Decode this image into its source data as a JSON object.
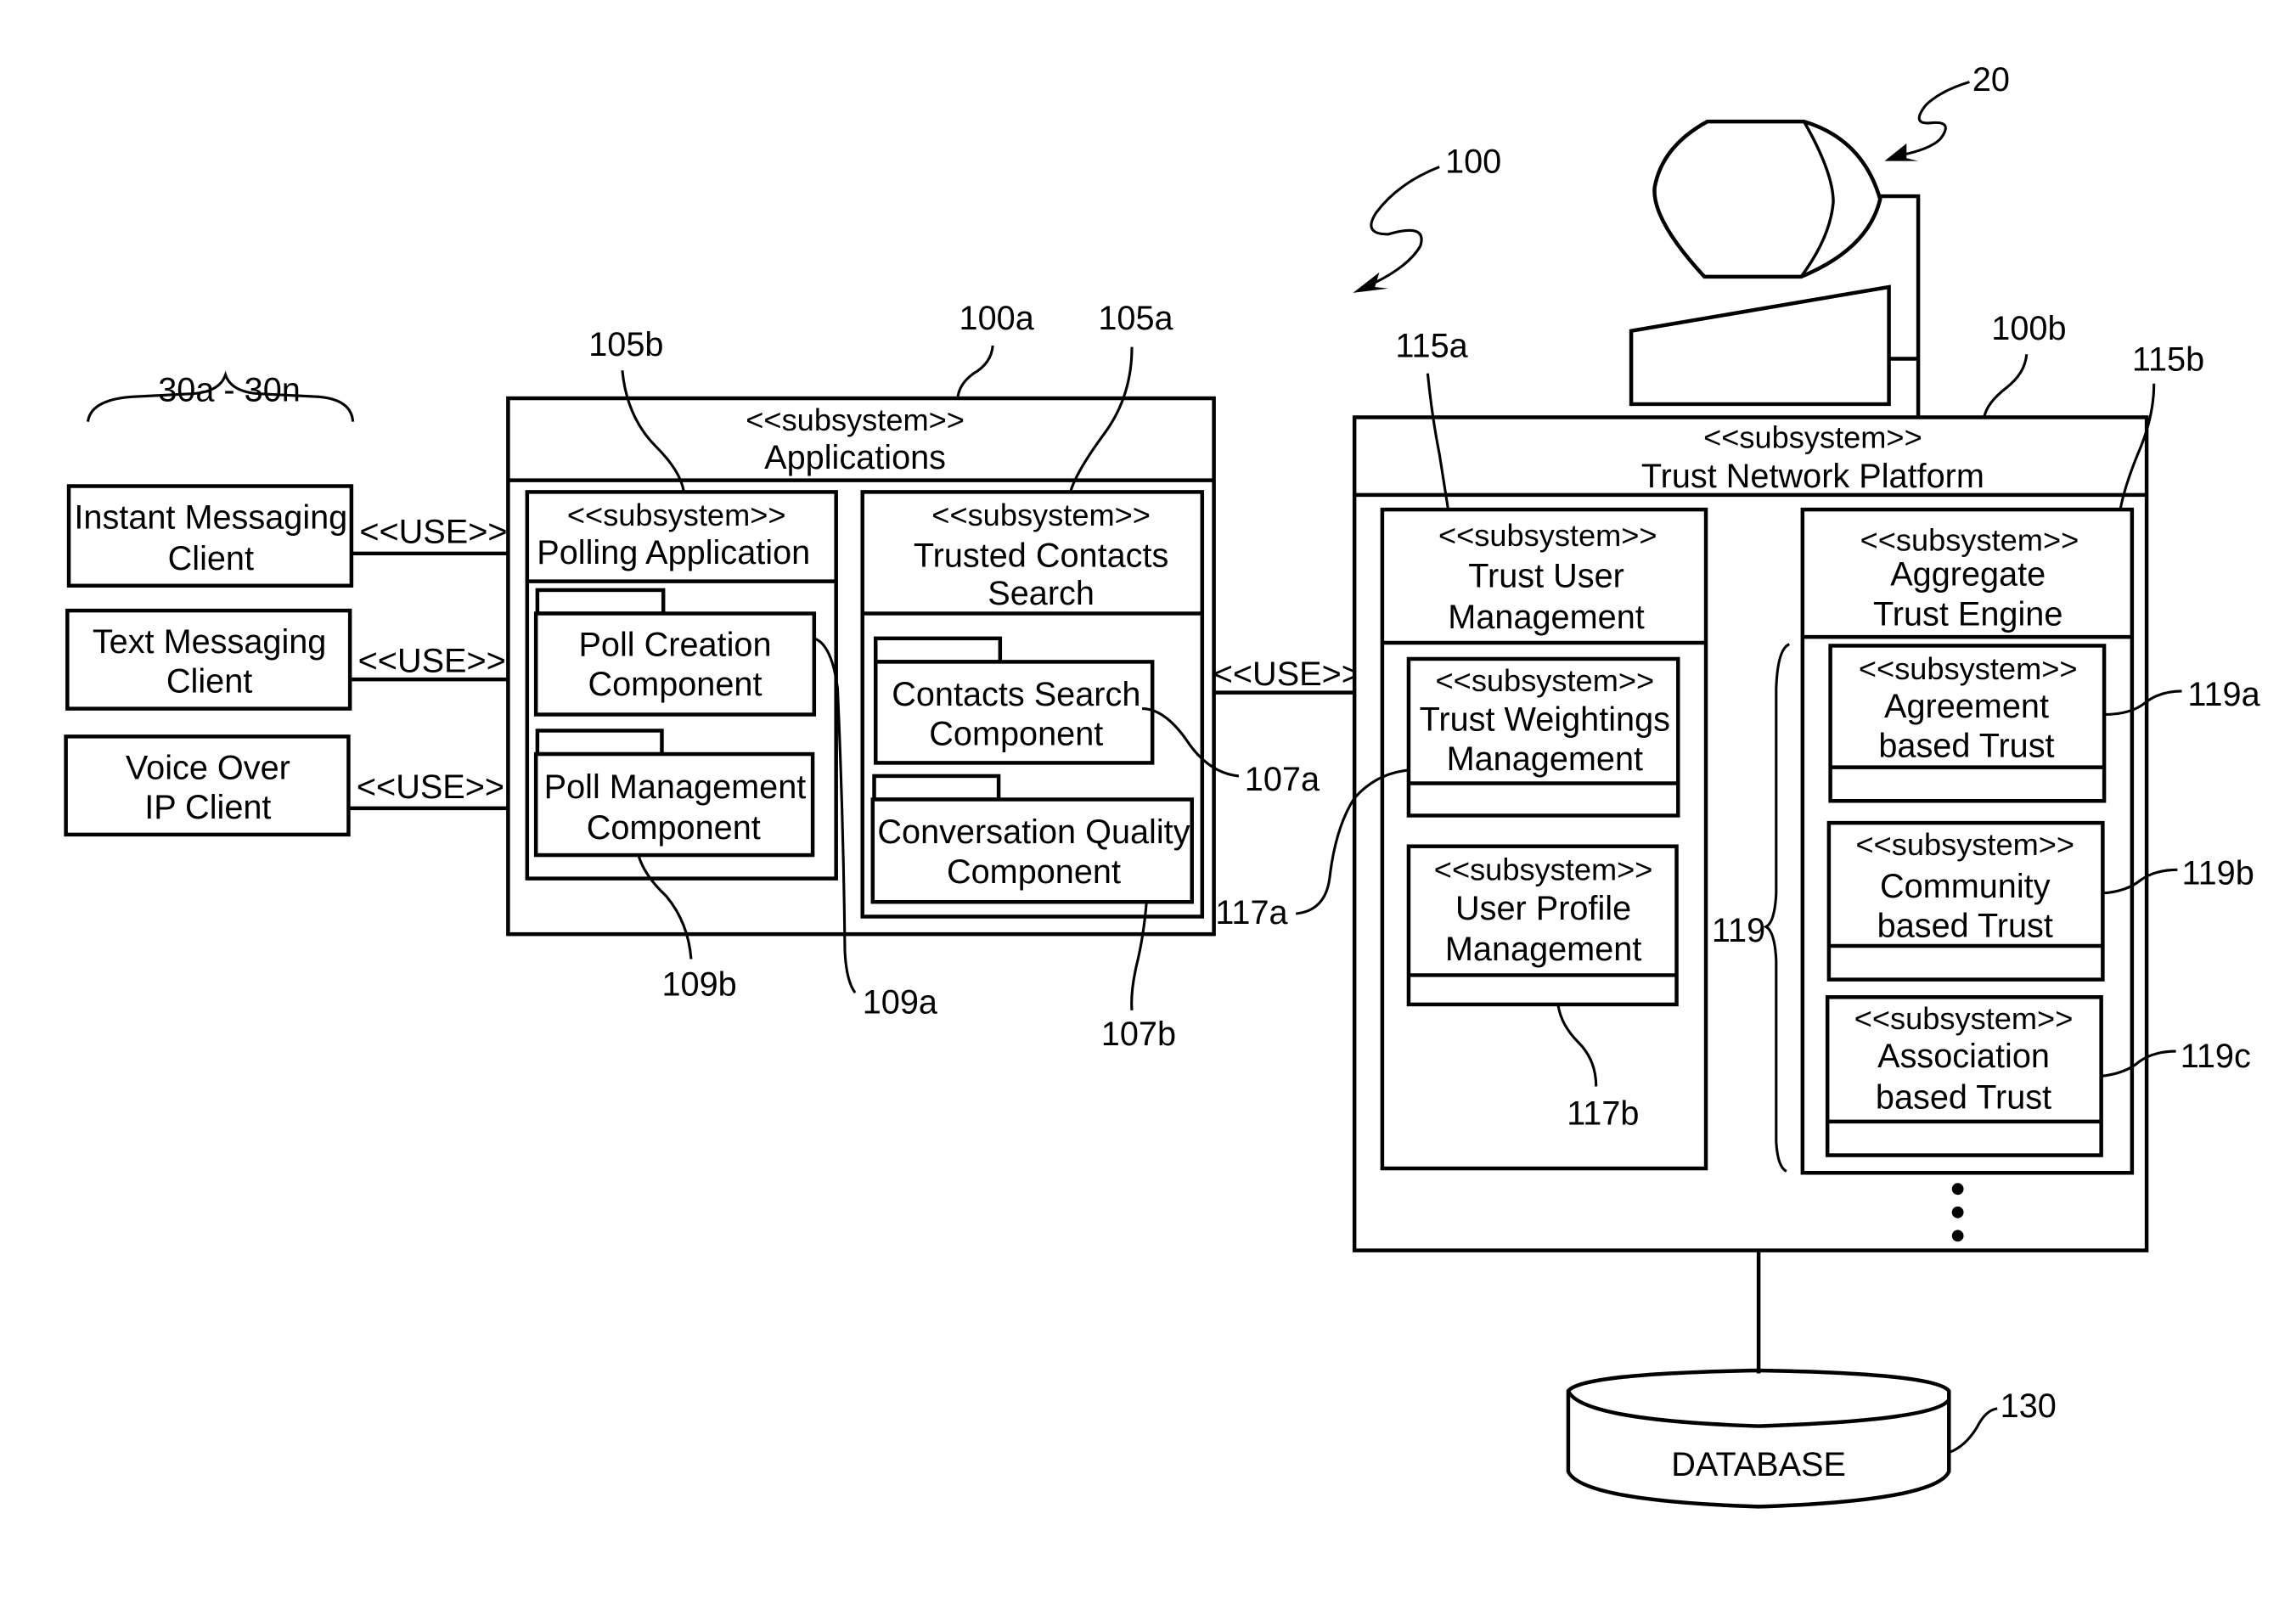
{
  "diagram": {
    "type": "UML subsystem architecture diagram",
    "stereotype": "<<subsystem>>",
    "use_label": "<<USE>>",
    "clients": {
      "ref": "30a - 30n",
      "items": [
        {
          "line1": "Instant Messaging",
          "line2": "Client"
        },
        {
          "line1": "Text Messaging",
          "line2": "Client"
        },
        {
          "line1": "Voice Over",
          "line2": "IP Client"
        }
      ]
    },
    "applications": {
      "ref": "100a",
      "title": "Applications",
      "polling": {
        "ref": "105b",
        "title": "Polling Application",
        "components": [
          {
            "ref": "109a",
            "line1": "Poll Creation",
            "line2": "Component"
          },
          {
            "ref": "109b",
            "line1": "Poll Management",
            "line2": "Component"
          }
        ]
      },
      "trusted_contacts": {
        "ref": "105a",
        "title_line1": "Trusted Contacts",
        "title_line2": "Search",
        "components": [
          {
            "ref": "107a",
            "line1": "Contacts Search",
            "line2": "Component"
          },
          {
            "ref": "107b",
            "line1": "Conversation Quality",
            "line2": "Component"
          }
        ]
      }
    },
    "system_ref": "100",
    "computer_ref": "20",
    "platform": {
      "ref": "100b",
      "title": "Trust Network Platform",
      "trust_user_mgmt": {
        "ref": "115a",
        "title_line1": "Trust User",
        "title_line2": "Management",
        "subsystems": [
          {
            "ref": "117a",
            "line1": "Trust Weightings",
            "line2": "Management"
          },
          {
            "ref": "117b",
            "line1": "User Profile",
            "line2": "Management"
          }
        ]
      },
      "aggregate_engine": {
        "ref": "115b",
        "group_ref": "119",
        "title_line1": "Aggregate",
        "title_line2": "Trust Engine",
        "subsystems": [
          {
            "ref": "119a",
            "line1": "Agreement",
            "line2": "based Trust"
          },
          {
            "ref": "119b",
            "line1": "Community",
            "line2": "based Trust"
          },
          {
            "ref": "119c",
            "line1": "Association",
            "line2": "based Trust"
          }
        ]
      }
    },
    "database": {
      "ref": "130",
      "label": "DATABASE"
    }
  }
}
